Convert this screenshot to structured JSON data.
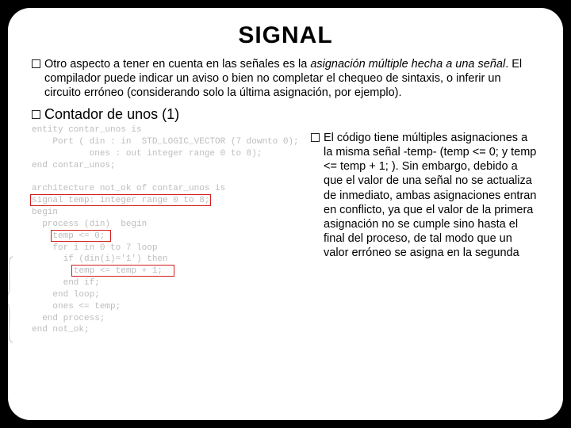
{
  "title": "SIGNAL",
  "para1_a": "Otro aspecto a tener en cuenta en las señales es la ",
  "para1_italic": "asignación múltiple hecha a una señal",
  "para1_b": ". El compilador puede indicar un aviso o bien no completar el chequeo de sintaxis, o inferir un circuito erróneo (considerando solo la última asignación, por ejemplo).",
  "subhead": "Contador de unos (1)",
  "code": "entity contar_unos is\n    Port ( din : in  STD_LOGIC_VECTOR (7 downto 0);\n           ones : out integer range 0 to 8);\nend contar_unos;\n\narchitecture not_ok of contar_unos is\nsignal temp: integer range 0 to 8;\nbegin\n  process (din)  begin\n    temp <= 0;\n    for i in 0 to 7 loop\n      if (din(i)='1') then\n        temp <= temp + 1;\n      end if;\n    end loop;\n    ones <= temp;\n  end process;\nend not_ok;",
  "right": "El código tiene múltiples asignaciones a la misma señal -temp- (temp <= 0; y temp <= temp + 1; ). Sin embargo, debido a que el valor de una señal no se actualiza de inmediato, ambas asignaciones entran en conflicto, ya que el valor de la primera asignación no se cumple sino hasta el final del proceso, de tal modo que un valor erróneo se asigna en la segunda"
}
